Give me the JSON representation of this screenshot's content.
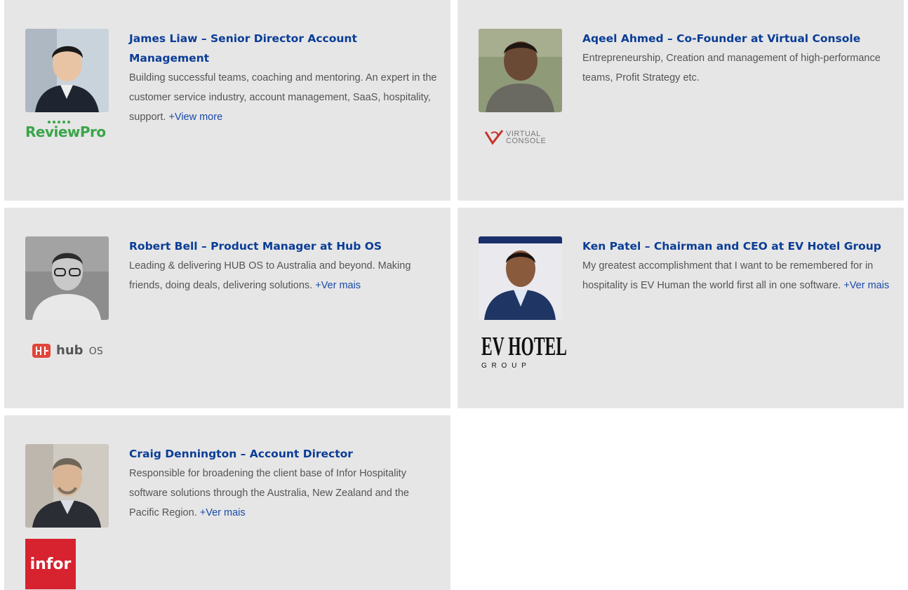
{
  "cards": [
    {
      "name": "James Liaw – Senior Director Account Management",
      "description": "Building successful teams, coaching and mentoring. An expert in the customer service industry, account management, SaaS, hospitality, support.",
      "more_link": "+View more",
      "company_logo": {
        "text": "ReviewPro",
        "icon": "reviewpro-logo"
      }
    },
    {
      "name": "Aqeel Ahmed – Co-Founder at Virtual Console",
      "description": "Entrepreneurship, Creation and management of high-performance teams, Profit Strategy etc.",
      "more_link": "",
      "company_logo": {
        "text_line1": "VIRTUAL",
        "text_line2": "CONSOLE",
        "icon": "virtual-console-logo"
      }
    },
    {
      "name": "Robert Bell – Product Manager at Hub OS",
      "description": "Leading & delivering HUB OS to Australia and beyond. Making friends, doing deals, delivering solutions.",
      "more_link": "+Ver mais",
      "company_logo": {
        "text": "hub",
        "text_suffix": "OS",
        "icon": "hub-os-logo"
      }
    },
    {
      "name": "Ken Patel – Chairman and CEO at EV Hotel Group",
      "description": "My greatest accomplishment that I want to be remembered for in hospitality is EV Human the world first all in one software.",
      "more_link": "+Ver mais",
      "company_logo": {
        "text_line1": "EV HOTEL",
        "text_line2": "G R O U P",
        "icon": "ev-hotel-group-logo"
      }
    },
    {
      "name": "Craig Dennington – Account Director",
      "description": "Responsible for broadening the client base of Infor Hospitality software solutions through the Australia, New Zealand and the Pacific Region.",
      "more_link": "+Ver mais",
      "company_logo": {
        "text": "infor",
        "icon": "infor-logo"
      }
    }
  ],
  "colors": {
    "card_background": "#e6e6e6",
    "name_color": "#0a3d96",
    "text_color": "#555555",
    "link_color": "#1a4aa8",
    "infor_red": "#d7232f",
    "reviewpro_green": "#3aa54a"
  }
}
